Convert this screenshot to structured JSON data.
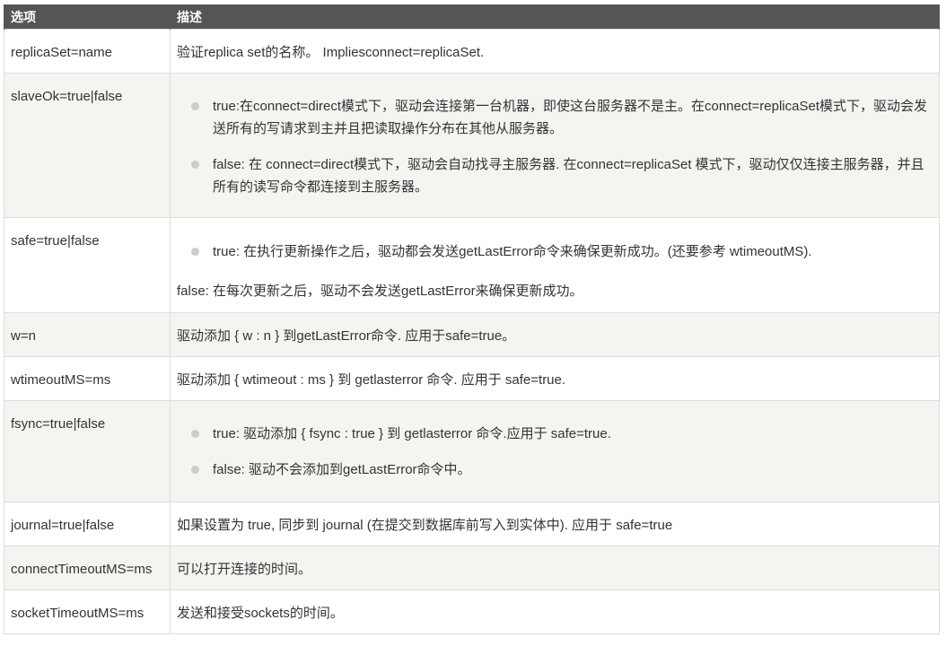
{
  "header": {
    "option": "选项",
    "description": "描述"
  },
  "rows": [
    {
      "key": "replicaSet=name",
      "desc": "验证replica set的名称。 Impliesconnect=replicaSet."
    },
    {
      "key": "slaveOk=true|false",
      "bullets": [
        "true:在connect=direct模式下，驱动会连接第一台机器，即使这台服务器不是主。在connect=replicaSet模式下，驱动会发送所有的写请求到主并且把读取操作分布在其他从服务器。",
        "false: 在 connect=direct模式下，驱动会自动找寻主服务器. 在connect=replicaSet 模式下，驱动仅仅连接主服务器，并且所有的读写命令都连接到主服务器。"
      ]
    },
    {
      "key": "safe=true|false",
      "bullets": [
        "true: 在执行更新操作之后，驱动都会发送getLastError命令来确保更新成功。(还要参考 wtimeoutMS)."
      ],
      "after": "false: 在每次更新之后，驱动不会发送getLastError来确保更新成功。"
    },
    {
      "key": "w=n",
      "desc": "驱动添加 { w : n } 到getLastError命令. 应用于safe=true。"
    },
    {
      "key": "wtimeoutMS=ms",
      "desc": "驱动添加 { wtimeout : ms } 到 getlasterror 命令. 应用于 safe=true."
    },
    {
      "key": "fsync=true|false",
      "bullets": [
        "true: 驱动添加 { fsync : true } 到 getlasterror 命令.应用于 safe=true.",
        "false: 驱动不会添加到getLastError命令中。"
      ]
    },
    {
      "key": "journal=true|false",
      "desc": "如果设置为 true, 同步到 journal (在提交到数据库前写入到实体中). 应用于 safe=true"
    },
    {
      "key": "connectTimeoutMS=ms",
      "desc": "可以打开连接的时间。"
    },
    {
      "key": "socketTimeoutMS=ms",
      "desc": "发送和接受sockets的时间。"
    }
  ]
}
